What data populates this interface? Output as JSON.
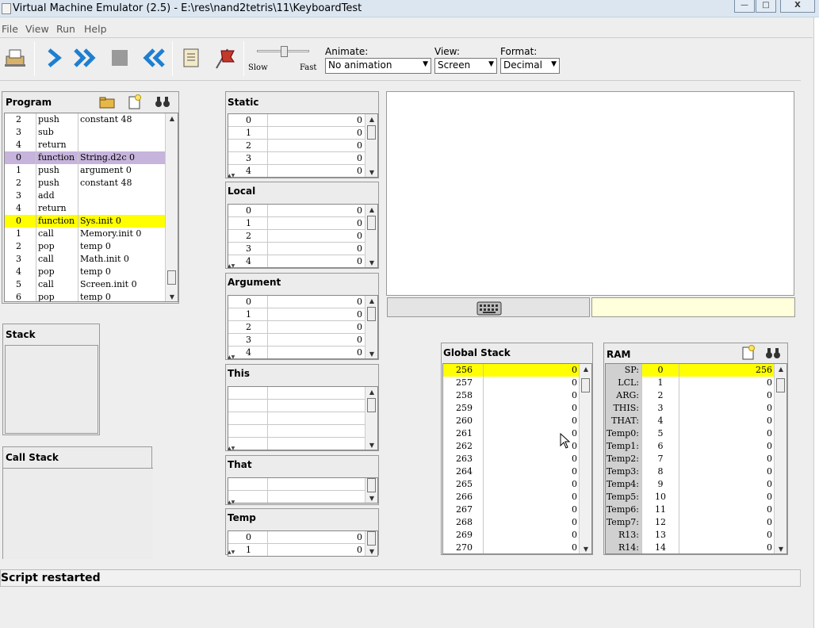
{
  "window": {
    "title": "Virtual Machine Emulator (2.5) - E:\\res\\nand2tetris\\11\\KeyboardTest",
    "min": "—",
    "max": "□",
    "close": "X"
  },
  "menu": [
    "File",
    "View",
    "Run",
    "Help"
  ],
  "toolbar": {
    "speed_slow": "Slow",
    "speed_fast": "Fast",
    "animate_label": "Animate:",
    "animate_value": "No animation",
    "view_label": "View:",
    "view_value": "Screen",
    "format_label": "Format:",
    "format_value": "Decimal"
  },
  "program": {
    "title": "Program",
    "rows": [
      {
        "n": "2",
        "cmd": "push",
        "arg": "constant 48",
        "hl": ""
      },
      {
        "n": "3",
        "cmd": "sub",
        "arg": "",
        "hl": ""
      },
      {
        "n": "4",
        "cmd": "return",
        "arg": "",
        "hl": ""
      },
      {
        "n": "0",
        "cmd": "function",
        "arg": "String.d2c 0",
        "hl": "purple"
      },
      {
        "n": "1",
        "cmd": "push",
        "arg": "argument 0",
        "hl": ""
      },
      {
        "n": "2",
        "cmd": "push",
        "arg": "constant 48",
        "hl": ""
      },
      {
        "n": "3",
        "cmd": "add",
        "arg": "",
        "hl": ""
      },
      {
        "n": "4",
        "cmd": "return",
        "arg": "",
        "hl": ""
      },
      {
        "n": "0",
        "cmd": "function",
        "arg": "Sys.init 0",
        "hl": "yellow"
      },
      {
        "n": "1",
        "cmd": "call",
        "arg": "Memory.init 0",
        "hl": ""
      },
      {
        "n": "2",
        "cmd": "pop",
        "arg": "temp 0",
        "hl": ""
      },
      {
        "n": "3",
        "cmd": "call",
        "arg": "Math.init 0",
        "hl": ""
      },
      {
        "n": "4",
        "cmd": "pop",
        "arg": "temp 0",
        "hl": ""
      },
      {
        "n": "5",
        "cmd": "call",
        "arg": "Screen.init 0",
        "hl": ""
      },
      {
        "n": "6",
        "cmd": "pop",
        "arg": "temp 0",
        "hl": ""
      }
    ]
  },
  "stack": {
    "title": "Stack"
  },
  "call_stack": {
    "title": "Call Stack"
  },
  "segments": {
    "static": {
      "title": "Static",
      "rows": [
        [
          "0",
          "0"
        ],
        [
          "1",
          "0"
        ],
        [
          "2",
          "0"
        ],
        [
          "3",
          "0"
        ],
        [
          "4",
          "0"
        ]
      ]
    },
    "local": {
      "title": "Local",
      "rows": [
        [
          "0",
          "0"
        ],
        [
          "1",
          "0"
        ],
        [
          "2",
          "0"
        ],
        [
          "3",
          "0"
        ],
        [
          "4",
          "0"
        ]
      ]
    },
    "argument": {
      "title": "Argument",
      "rows": [
        [
          "0",
          "0"
        ],
        [
          "1",
          "0"
        ],
        [
          "2",
          "0"
        ],
        [
          "3",
          "0"
        ],
        [
          "4",
          "0"
        ]
      ]
    },
    "this": {
      "title": "This",
      "rows": [
        [
          "",
          ""
        ],
        [
          "",
          ""
        ],
        [
          "",
          ""
        ],
        [
          "",
          ""
        ],
        [
          "",
          ""
        ]
      ]
    },
    "that": {
      "title": "That",
      "rows": [
        [
          "",
          ""
        ],
        [
          "",
          ""
        ]
      ]
    },
    "temp": {
      "title": "Temp",
      "rows": [
        [
          "0",
          "0"
        ],
        [
          "1",
          "0"
        ]
      ]
    }
  },
  "global_stack": {
    "title": "Global Stack",
    "rows": [
      [
        "256",
        "0"
      ],
      [
        "257",
        "0"
      ],
      [
        "258",
        "0"
      ],
      [
        "259",
        "0"
      ],
      [
        "260",
        "0"
      ],
      [
        "261",
        "0"
      ],
      [
        "262",
        "0"
      ],
      [
        "263",
        "0"
      ],
      [
        "264",
        "0"
      ],
      [
        "265",
        "0"
      ],
      [
        "266",
        "0"
      ],
      [
        "267",
        "0"
      ],
      [
        "268",
        "0"
      ],
      [
        "269",
        "0"
      ],
      [
        "270",
        "0"
      ]
    ]
  },
  "ram": {
    "title": "RAM",
    "rows": [
      [
        "SP:",
        "0",
        "256"
      ],
      [
        "LCL:",
        "1",
        "0"
      ],
      [
        "ARG:",
        "2",
        "0"
      ],
      [
        "THIS:",
        "3",
        "0"
      ],
      [
        "THAT:",
        "4",
        "0"
      ],
      [
        "Temp0:",
        "5",
        "0"
      ],
      [
        "Temp1:",
        "6",
        "0"
      ],
      [
        "Temp2:",
        "7",
        "0"
      ],
      [
        "Temp3:",
        "8",
        "0"
      ],
      [
        "Temp4:",
        "9",
        "0"
      ],
      [
        "Temp5:",
        "10",
        "0"
      ],
      [
        "Temp6:",
        "11",
        "0"
      ],
      [
        "Temp7:",
        "12",
        "0"
      ],
      [
        "R13:",
        "13",
        "0"
      ],
      [
        "R14:",
        "14",
        "0"
      ]
    ]
  },
  "status": "Script restarted"
}
